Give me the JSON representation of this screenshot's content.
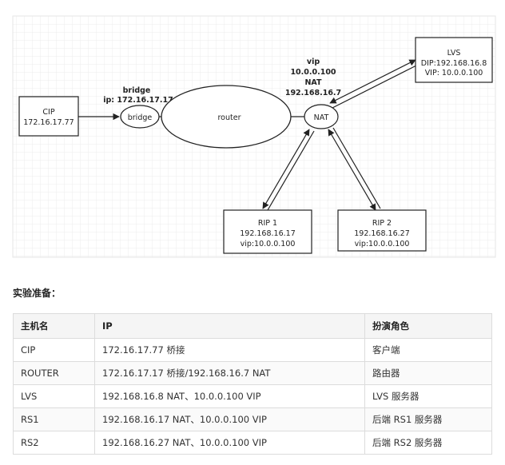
{
  "diagram": {
    "cip": {
      "title": "CIP",
      "ip": "172.16.17.77"
    },
    "bridge_label": {
      "line1": "bridge",
      "line2": "ip:  172.16.17.17"
    },
    "bridge_node": "bridge",
    "router_node": "router",
    "nat_node": "NAT",
    "nat_label": {
      "line1": "vip",
      "line2": "10.0.0.100",
      "line3": "NAT",
      "line4": "192.168.16.7"
    },
    "lvs": {
      "title": "LVS",
      "dip": "DIP:192.168.16.8",
      "vip": "VIP: 10.0.0.100"
    },
    "rip1": {
      "title": "RIP 1",
      "ip": "192.168.16.17",
      "vip": "vip:10.0.0.100"
    },
    "rip2": {
      "title": "RIP 2",
      "ip": "192.168.16.27",
      "vip": "vip:10.0.0.100"
    }
  },
  "section_title": "实验准备：",
  "table": {
    "headers": [
      "主机名",
      "IP",
      "扮演角色"
    ],
    "rows": [
      [
        "CIP",
        "172.16.17.77 桥接",
        "客户端"
      ],
      [
        "ROUTER",
        "172.16.17.17 桥接/192.168.16.7 NAT",
        "路由器"
      ],
      [
        "LVS",
        "192.168.16.8   NAT、10.0.0.100 VIP",
        "LVS 服务器"
      ],
      [
        "RS1",
        "192.168.16.17  NAT、10.0.0.100 VIP",
        "后端 RS1 服务器"
      ],
      [
        "RS2",
        "192.168.16.27  NAT、10.0.0.100 VIP",
        "后端 RS2 服务器"
      ]
    ]
  }
}
